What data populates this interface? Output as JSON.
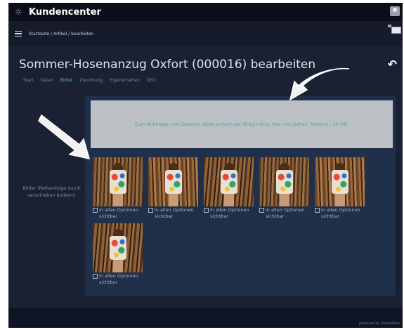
{
  "header": {
    "app_title": "Kundencenter",
    "logo_icon": "gear-logo-icon",
    "avatar_icon": "user-avatar-icon"
  },
  "breadcrumb": "Startseite / Artikel / bearbeiten",
  "page": {
    "title": "Sommer-Hosenanzug Oxfort (000016) bearbeiten",
    "back_icon": "back-arrow-icon"
  },
  "tabs": [
    {
      "label": "Start",
      "active": false
    },
    {
      "label": "Daten",
      "active": false
    },
    {
      "label": "Bilder",
      "active": true
    },
    {
      "label": "Zuordnung",
      "active": false
    },
    {
      "label": "Eigenschaften",
      "active": false
    },
    {
      "label": "SEO",
      "active": false
    }
  ],
  "images_section": {
    "sidebar_label": "Bilder (Reihenfolge durch verschieben ändern):",
    "dropzone_text": "Zum Anhängen von Dateien, diese einfach per Drag'n'Drop hier rein ziehen. Maxima.: 20 MB.",
    "images": [
      {
        "caption": "in allen Optionen sichtbar",
        "checked": false
      },
      {
        "caption": "in allen Optionen sichtbar",
        "checked": false
      },
      {
        "caption": "in allen Optionen sichtbar",
        "checked": false
      },
      {
        "caption": "in allen Optionen sichtbar",
        "checked": false
      },
      {
        "caption": "in allen Optionen sichtbar",
        "checked": false
      },
      {
        "caption": "in allen Optionen sichtbar",
        "checked": false
      }
    ]
  },
  "footer": "powered by ScherWare",
  "colors": {
    "accent": "#3fc3e0",
    "background": "#1a2133",
    "panel": "#21304a",
    "dropzone": "#bcc0c4"
  }
}
